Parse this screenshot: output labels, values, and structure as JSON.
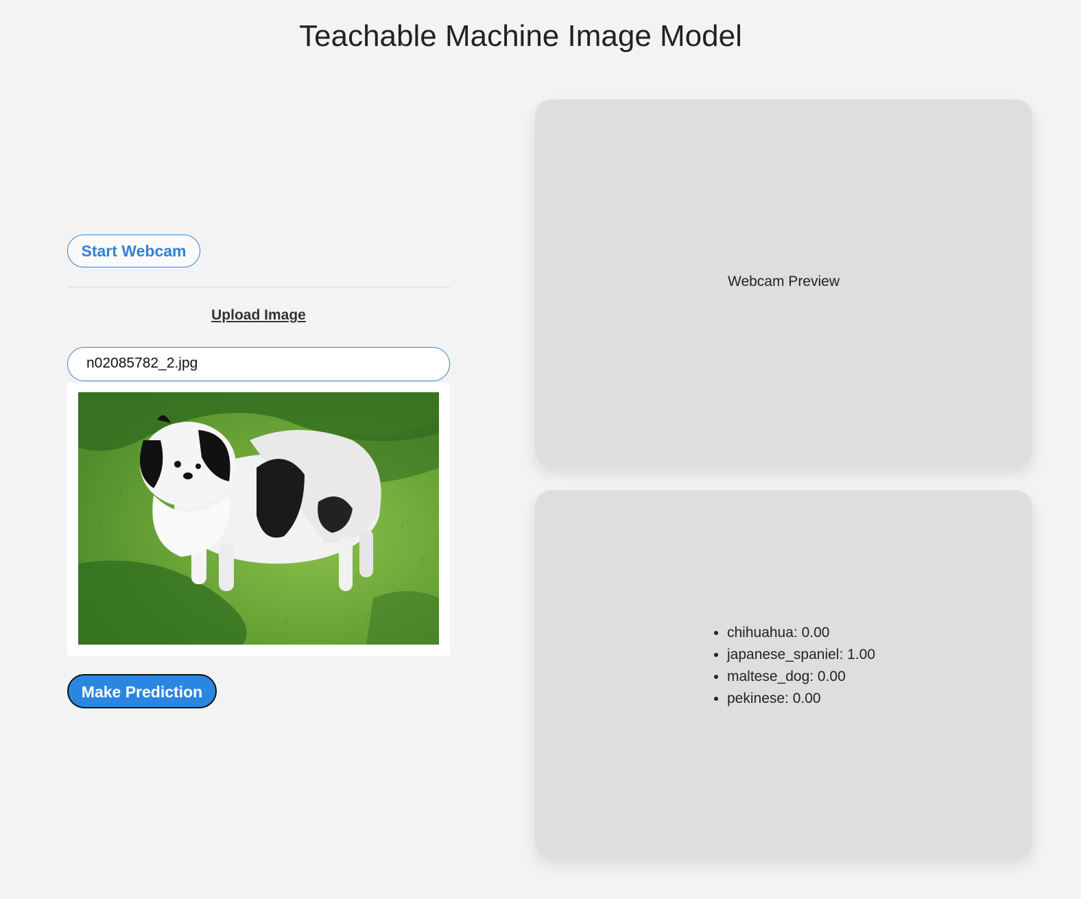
{
  "header": {
    "title": "Teachable Machine Image Model"
  },
  "controls": {
    "start_webcam_label": "Start Webcam",
    "upload_label": "Upload Image",
    "file_name": "n02085782_2.jpg",
    "predict_label": "Make Prediction"
  },
  "webcam": {
    "placeholder": "Webcam Preview"
  },
  "results": {
    "items": [
      "chihuahua: 0.00",
      "japanese_spaniel: 1.00",
      "maltese_dog: 0.00",
      "pekinese: 0.00"
    ]
  },
  "colors": {
    "accent": "#2b86df",
    "background": "#f3f3f3",
    "panel": "#dedede"
  }
}
